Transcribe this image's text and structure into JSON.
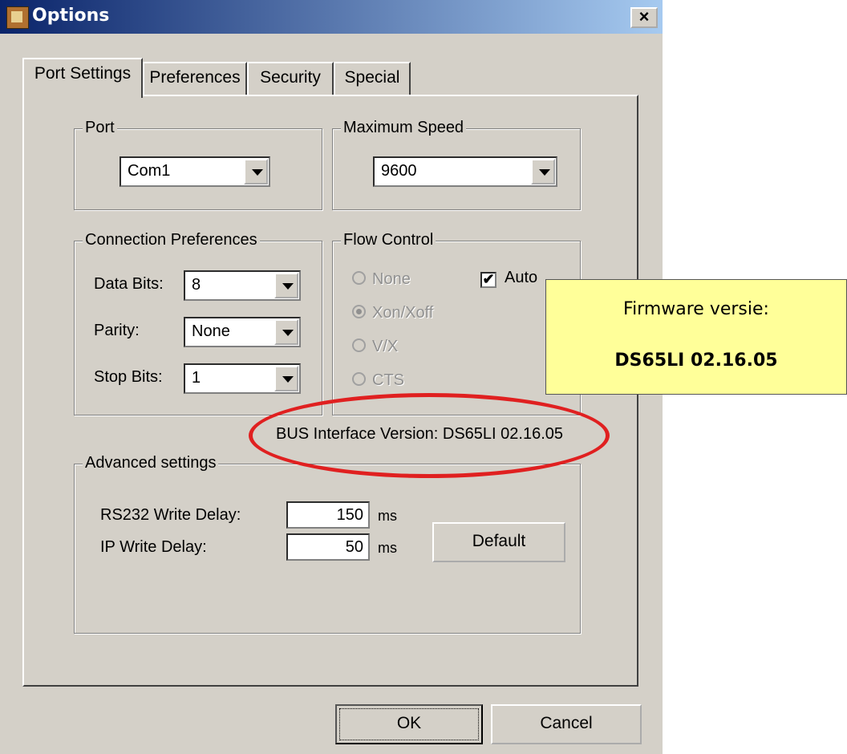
{
  "window": {
    "title": "Options",
    "close_label": "×"
  },
  "tabs": [
    {
      "label": "Port Settings"
    },
    {
      "label": "Preferences"
    },
    {
      "label": "Security"
    },
    {
      "label": "Special"
    }
  ],
  "port": {
    "label": "Port",
    "value": "Com1"
  },
  "speed": {
    "label": "Maximum Speed",
    "value": "9600"
  },
  "connection": {
    "label": "Connection Preferences",
    "data_bits_label": "Data Bits:",
    "data_bits_value": "8",
    "parity_label": "Parity:",
    "parity_value": "None",
    "stop_bits_label": "Stop Bits:",
    "stop_bits_value": "1"
  },
  "flow": {
    "label": "Flow Control",
    "options": [
      {
        "label": "None",
        "selected": false
      },
      {
        "label": "Xon/Xoff",
        "selected": true
      },
      {
        "label": "V/X",
        "selected": false
      },
      {
        "label": "CTS",
        "selected": false
      }
    ],
    "auto_label": "Auto",
    "auto_checked": true,
    "check_mark": "✔"
  },
  "bus_version": "BUS Interface Version: DS65LI 02.16.05",
  "advanced": {
    "label": "Advanced settings",
    "rs232_label": "RS232 Write Delay:",
    "rs232_value": "150",
    "rs232_unit": "ms",
    "ip_label": "IP Write Delay:",
    "ip_value": "50",
    "ip_unit": "ms",
    "default_label": "Default"
  },
  "buttons": {
    "ok": "OK",
    "cancel": "Cancel"
  },
  "annotation": {
    "line1": "Firmware versie:",
    "line2": "DS65LI 02.16.05",
    "highlight_color": "#e02020",
    "note_color": "#ffff99"
  }
}
